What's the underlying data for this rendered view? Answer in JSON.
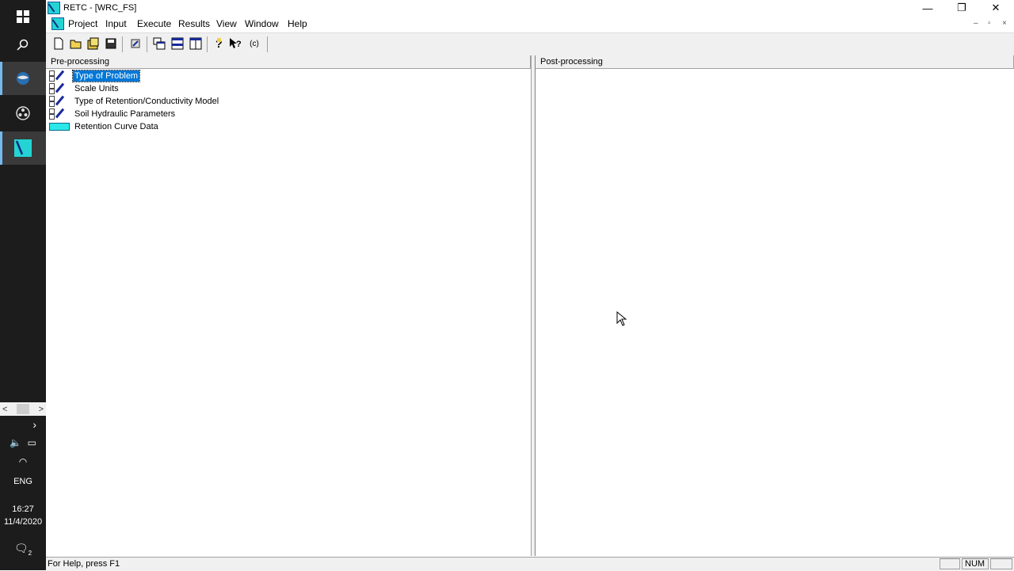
{
  "app": {
    "title": "RETC - [WRC_FS]",
    "window_controls": {
      "minimize": "—",
      "restore": "❐",
      "close": "✕"
    },
    "mdi_controls": {
      "minimize": "–",
      "restore": "▫",
      "close": "×"
    }
  },
  "menu": {
    "items": [
      "Project",
      "Input",
      "Execute",
      "Results",
      "View",
      "Window",
      "Help"
    ]
  },
  "toolbar": {
    "buttons": [
      {
        "name": "new-file-icon",
        "glyph": "🗋"
      },
      {
        "name": "open-folder-icon",
        "glyph": "📂"
      },
      {
        "name": "open-project-icon",
        "glyph": "▤"
      },
      {
        "name": "save-icon",
        "glyph": "▣"
      },
      {
        "name": "run-icon",
        "glyph": "⚙"
      },
      {
        "name": "cascade-windows-icon",
        "glyph": "❐"
      },
      {
        "name": "tile-horizontal-icon",
        "glyph": "☰"
      },
      {
        "name": "tile-vertical-icon",
        "glyph": "◫"
      },
      {
        "name": "help-topics-icon",
        "glyph": "?"
      },
      {
        "name": "context-help-icon",
        "glyph": "↖?"
      },
      {
        "name": "about-icon",
        "glyph": "(c)"
      }
    ]
  },
  "preprocessing": {
    "header": "Pre-processing",
    "items": [
      {
        "label": "Type of Problem",
        "selected": true
      },
      {
        "label": "Scale Units",
        "selected": false
      },
      {
        "label": "Type of Retention/Conductivity Model",
        "selected": false
      },
      {
        "label": "Soil Hydraulic Parameters",
        "selected": false
      },
      {
        "label": "Retention Curve Data",
        "selected": false
      }
    ]
  },
  "postprocessing": {
    "header": "Post-processing"
  },
  "statusbar": {
    "help_text": "For Help, press F1",
    "num": "NUM"
  },
  "taskbar": {
    "language": "ENG",
    "time": "16:27",
    "date": "11/4/2020",
    "notifications": "2",
    "accent": "#76b9ed"
  }
}
